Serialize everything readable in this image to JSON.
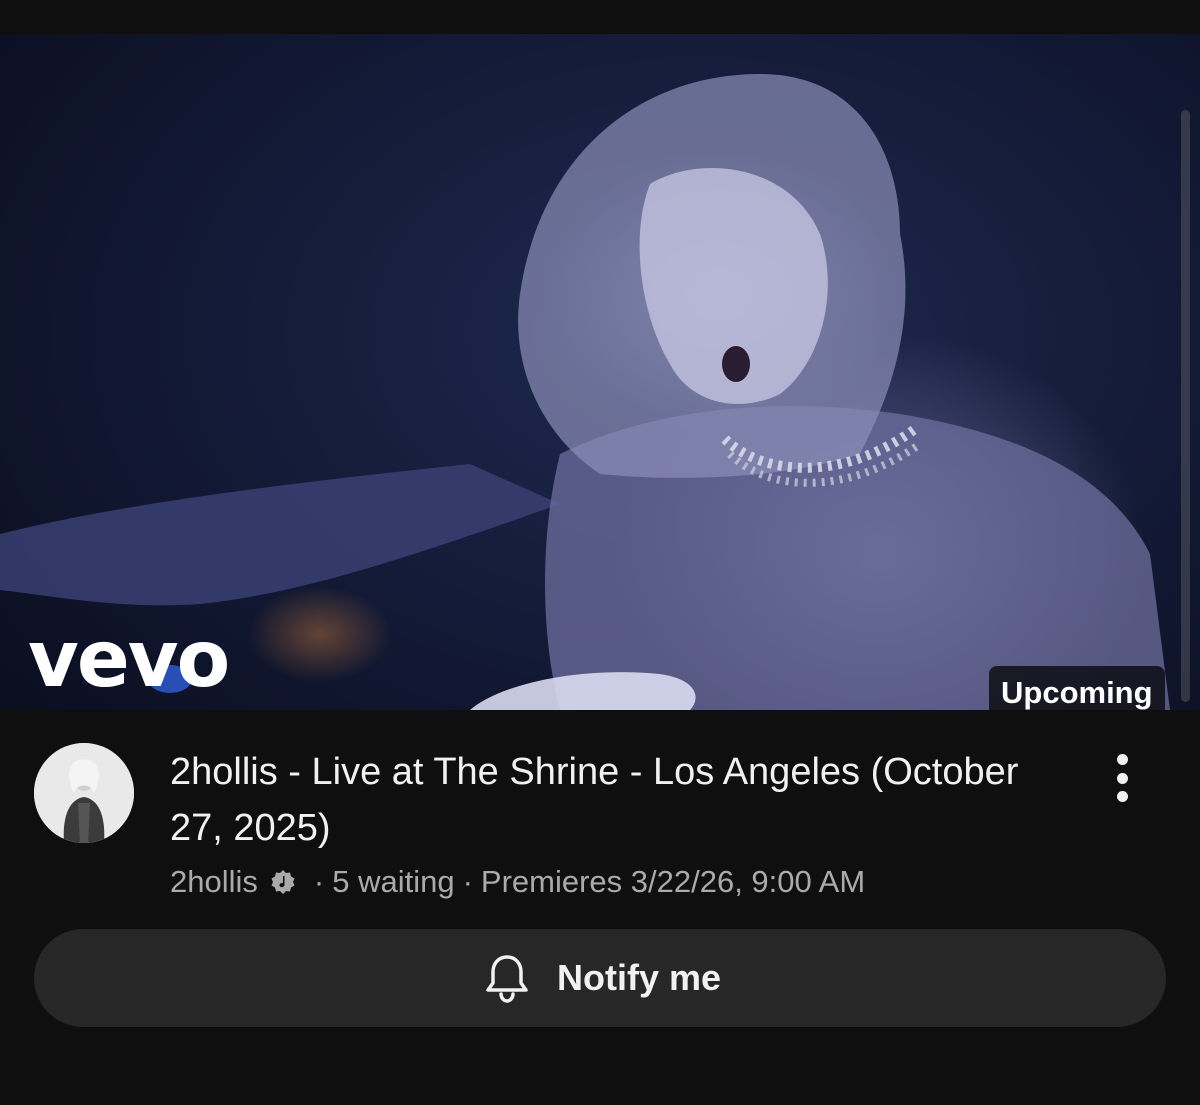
{
  "thumbnail": {
    "logo_text": "vevo",
    "badge": "Upcoming"
  },
  "video": {
    "title": "2hollis - Live at The Shrine - Los Angeles (October 27, 2025)",
    "channel": "2hollis",
    "separator": "·",
    "waiting": "5 waiting",
    "premiere": "Premieres 3/22/26, 9:00 AM"
  },
  "actions": {
    "notify_label": "Notify me",
    "more_icon": "more-vertical-icon",
    "bell_icon": "bell-icon",
    "verified_icon": "verified-artist-icon"
  },
  "colors": {
    "background": "#0f0f0f",
    "button_bg": "#272727",
    "secondary_text": "#aaaaaa",
    "primary_text": "#f1f1f1"
  }
}
